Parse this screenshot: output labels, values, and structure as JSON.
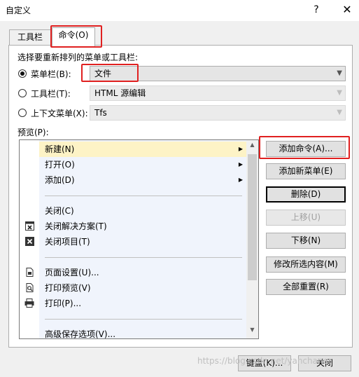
{
  "window": {
    "title": "自定义",
    "help": "?",
    "close": "✕"
  },
  "tabs": [
    {
      "label": "工具栏(S)"
    },
    {
      "label": "命令(O)"
    }
  ],
  "section_label": "选择要重新排列的菜单或工具栏:",
  "options": {
    "menubar": {
      "label": "菜单栏(B):",
      "value": "文件"
    },
    "toolbar": {
      "label": "工具栏(T):",
      "value": "HTML 源编辑"
    },
    "context": {
      "label": "上下文菜单(X):",
      "value": "Tfs"
    }
  },
  "preview_label": "预览(P):",
  "preview_items": [
    {
      "label": "新建(N)",
      "submenu": true,
      "highlighted": true
    },
    {
      "label": "打开(O)",
      "submenu": true
    },
    {
      "label": "添加(D)",
      "submenu": true
    },
    {
      "label": "关闭(C)"
    },
    {
      "label": "关闭解决方案(T)",
      "icon": "close-solution-icon"
    },
    {
      "label": "关闭项目(T)",
      "icon": "close-project-icon"
    },
    {
      "label": "页面设置(U)...",
      "icon": "page-setup-icon"
    },
    {
      "label": "打印预览(V)",
      "icon": "print-preview-icon"
    },
    {
      "label": "打印(P)...",
      "icon": "printer-icon"
    },
    {
      "label": "高级保存选项(V)..."
    }
  ],
  "buttons": {
    "add_command": "添加命令(A)...",
    "add_menu": "添加新菜单(E)",
    "delete": "删除(D)",
    "move_up": "上移(U)",
    "move_down": "下移(N)",
    "modify": "修改所选内容(M)",
    "reset_all": "全部重置(R)",
    "keyboard": "键盘(K)...",
    "close": "关闭"
  },
  "watermark": "https://blog.csdn.net/yanchaner"
}
